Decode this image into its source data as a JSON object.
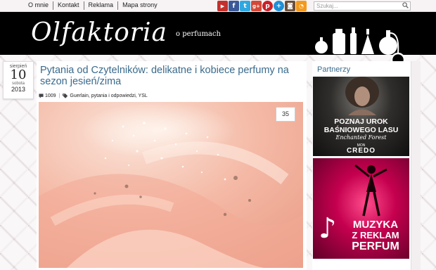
{
  "nav": {
    "items": [
      "O mnie",
      "Kontakt",
      "Reklama",
      "Mapa strony"
    ]
  },
  "social": [
    "youtube-icon",
    "facebook-icon",
    "twitter-icon",
    "googleplus-icon",
    "pinterest-icon",
    "plus-icon",
    "instagram-icon",
    "rss-icon"
  ],
  "search": {
    "placeholder": "Szukaj..."
  },
  "header": {
    "logo": "Olfaktoria",
    "tagline": "o perfumach"
  },
  "date": {
    "month": "sierpień",
    "day": "10",
    "weekday": "sobota",
    "year": "2013"
  },
  "article": {
    "title": "Pytania od Czytelników: delikatne i kobiece perfumy na sezon jesień/zima",
    "comment_id": "1009",
    "tags": "Guerlain, pytania i odpowiedzi, YSL",
    "comments": "35"
  },
  "sidebar": {
    "title": "Partnerzy",
    "ad1": {
      "line1": "POZNAJ UROK",
      "line2": "BAŚNIOWEGO LASU",
      "line3": "Enchanted Forest",
      "brand_small": "MON",
      "brand": "CREDO"
    },
    "ad2": {
      "line1": "MUZYKA",
      "line2": "Z REKLAM",
      "line3": "PERFUM"
    }
  }
}
